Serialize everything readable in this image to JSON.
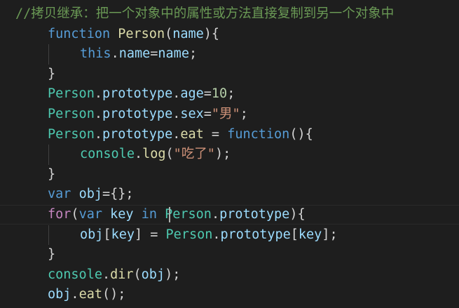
{
  "editor": {
    "lines": [
      {
        "indent": 0,
        "tokens": [
          {
            "t": "//拷贝继承：把一个对象中的属性或方法直接复制到另一个对象中",
            "c": "cmt"
          }
        ]
      },
      {
        "indent": 1,
        "tokens": [
          {
            "t": "function",
            "c": "kw"
          },
          {
            "t": " ",
            "c": "pun"
          },
          {
            "t": "Person",
            "c": "fn"
          },
          {
            "t": "(",
            "c": "pun"
          },
          {
            "t": "name",
            "c": "var"
          },
          {
            "t": "){",
            "c": "pun"
          }
        ]
      },
      {
        "indent": 2,
        "tokens": [
          {
            "t": "this",
            "c": "kw"
          },
          {
            "t": ".",
            "c": "pun"
          },
          {
            "t": "name",
            "c": "var"
          },
          {
            "t": "=",
            "c": "pun"
          },
          {
            "t": "name",
            "c": "var"
          },
          {
            "t": ";",
            "c": "pun"
          }
        ]
      },
      {
        "indent": 1,
        "tokens": [
          {
            "t": "}",
            "c": "pun"
          }
        ]
      },
      {
        "indent": 1,
        "tokens": [
          {
            "t": "Person",
            "c": "cls"
          },
          {
            "t": ".",
            "c": "pun"
          },
          {
            "t": "prototype",
            "c": "var"
          },
          {
            "t": ".",
            "c": "pun"
          },
          {
            "t": "age",
            "c": "var"
          },
          {
            "t": "=",
            "c": "pun"
          },
          {
            "t": "10",
            "c": "num"
          },
          {
            "t": ";",
            "c": "pun"
          }
        ]
      },
      {
        "indent": 1,
        "tokens": [
          {
            "t": "Person",
            "c": "cls"
          },
          {
            "t": ".",
            "c": "pun"
          },
          {
            "t": "prototype",
            "c": "var"
          },
          {
            "t": ".",
            "c": "pun"
          },
          {
            "t": "sex",
            "c": "var"
          },
          {
            "t": "=",
            "c": "pun"
          },
          {
            "t": "\"男\"",
            "c": "str"
          },
          {
            "t": ";",
            "c": "pun"
          }
        ]
      },
      {
        "indent": 1,
        "tokens": [
          {
            "t": "Person",
            "c": "cls"
          },
          {
            "t": ".",
            "c": "pun"
          },
          {
            "t": "prototype",
            "c": "var"
          },
          {
            "t": ".",
            "c": "pun"
          },
          {
            "t": "eat",
            "c": "fn"
          },
          {
            "t": " = ",
            "c": "pun"
          },
          {
            "t": "function",
            "c": "kw"
          },
          {
            "t": "(){",
            "c": "pun"
          }
        ]
      },
      {
        "indent": 2,
        "tokens": [
          {
            "t": "console",
            "c": "cls"
          },
          {
            "t": ".",
            "c": "pun"
          },
          {
            "t": "log",
            "c": "fn"
          },
          {
            "t": "(",
            "c": "pun"
          },
          {
            "t": "\"吃了\"",
            "c": "str"
          },
          {
            "t": ");",
            "c": "pun"
          }
        ]
      },
      {
        "indent": 1,
        "tokens": [
          {
            "t": "}",
            "c": "pun"
          }
        ]
      },
      {
        "indent": 1,
        "tokens": [
          {
            "t": "var",
            "c": "kw"
          },
          {
            "t": " ",
            "c": "pun"
          },
          {
            "t": "obj",
            "c": "var"
          },
          {
            "t": "={};",
            "c": "pun"
          }
        ]
      },
      {
        "indent": 1,
        "current": true,
        "tokens": [
          {
            "t": "for",
            "c": "ctl"
          },
          {
            "t": "(",
            "c": "pun"
          },
          {
            "t": "var",
            "c": "kw"
          },
          {
            "t": " ",
            "c": "pun"
          },
          {
            "t": "key",
            "c": "var"
          },
          {
            "t": " ",
            "c": "pun"
          },
          {
            "t": "in",
            "c": "kw"
          },
          {
            "t": " ",
            "c": "pun"
          },
          {
            "t": "Person",
            "c": "cls"
          },
          {
            "t": ".",
            "c": "pun"
          },
          {
            "t": "prototype",
            "c": "var"
          },
          {
            "t": "){",
            "c": "pun"
          }
        ]
      },
      {
        "indent": 2,
        "tokens": [
          {
            "t": "obj",
            "c": "var"
          },
          {
            "t": "[",
            "c": "pun"
          },
          {
            "t": "key",
            "c": "var"
          },
          {
            "t": "] = ",
            "c": "pun"
          },
          {
            "t": "Person",
            "c": "cls"
          },
          {
            "t": ".",
            "c": "pun"
          },
          {
            "t": "prototype",
            "c": "var"
          },
          {
            "t": "[",
            "c": "pun"
          },
          {
            "t": "key",
            "c": "var"
          },
          {
            "t": "];",
            "c": "pun"
          }
        ]
      },
      {
        "indent": 1,
        "tokens": [
          {
            "t": "}",
            "c": "pun"
          }
        ]
      },
      {
        "indent": 1,
        "tokens": [
          {
            "t": "console",
            "c": "cls"
          },
          {
            "t": ".",
            "c": "pun"
          },
          {
            "t": "dir",
            "c": "fn"
          },
          {
            "t": "(",
            "c": "pun"
          },
          {
            "t": "obj",
            "c": "var"
          },
          {
            "t": ");",
            "c": "pun"
          }
        ]
      },
      {
        "indent": 1,
        "tokens": [
          {
            "t": "obj",
            "c": "var"
          },
          {
            "t": ".",
            "c": "pun"
          },
          {
            "t": "eat",
            "c": "fn"
          },
          {
            "t": "();",
            "c": "pun"
          }
        ]
      }
    ]
  },
  "colors": {
    "background": "#1e1e1e",
    "comment": "#6a9955",
    "keyword": "#569cd6",
    "control": "#c586c0",
    "function": "#dcdcaa",
    "class": "#4ec9b0",
    "variable": "#9cdcfe",
    "number": "#b5cea8",
    "string": "#ce9178",
    "punctuation": "#d4d4d4"
  }
}
